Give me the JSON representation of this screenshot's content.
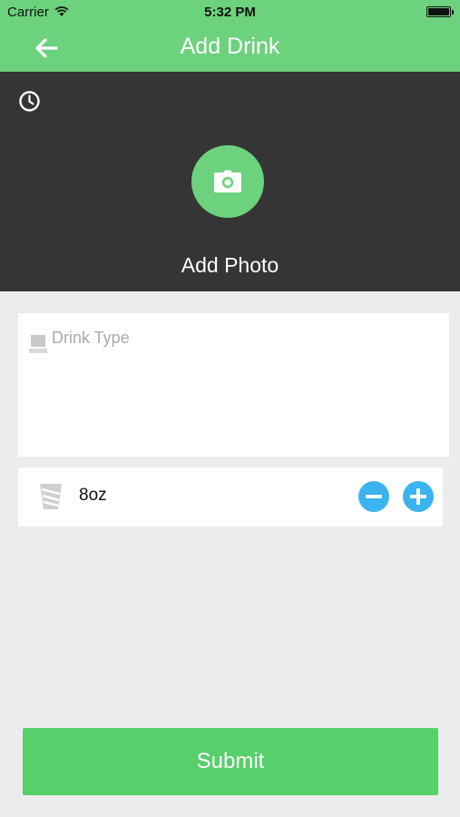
{
  "status_bar": {
    "carrier": "Carrier",
    "time": "5:32 PM"
  },
  "nav": {
    "title": "Add Drink",
    "back_icon": "arrow-left-icon"
  },
  "photo": {
    "label": "Add Photo",
    "camera_icon": "camera-icon",
    "history_icon": "clock-icon"
  },
  "drink_type": {
    "placeholder": "Drink Type",
    "value": ""
  },
  "size": {
    "value": "8oz"
  },
  "submit": {
    "label": "Submit"
  },
  "colors": {
    "header_green": "#6dd27e",
    "photo_bg": "#353535",
    "accent_blue": "#3ab3ee",
    "submit_green": "#57cf6b",
    "page_bg": "#ebeced"
  }
}
